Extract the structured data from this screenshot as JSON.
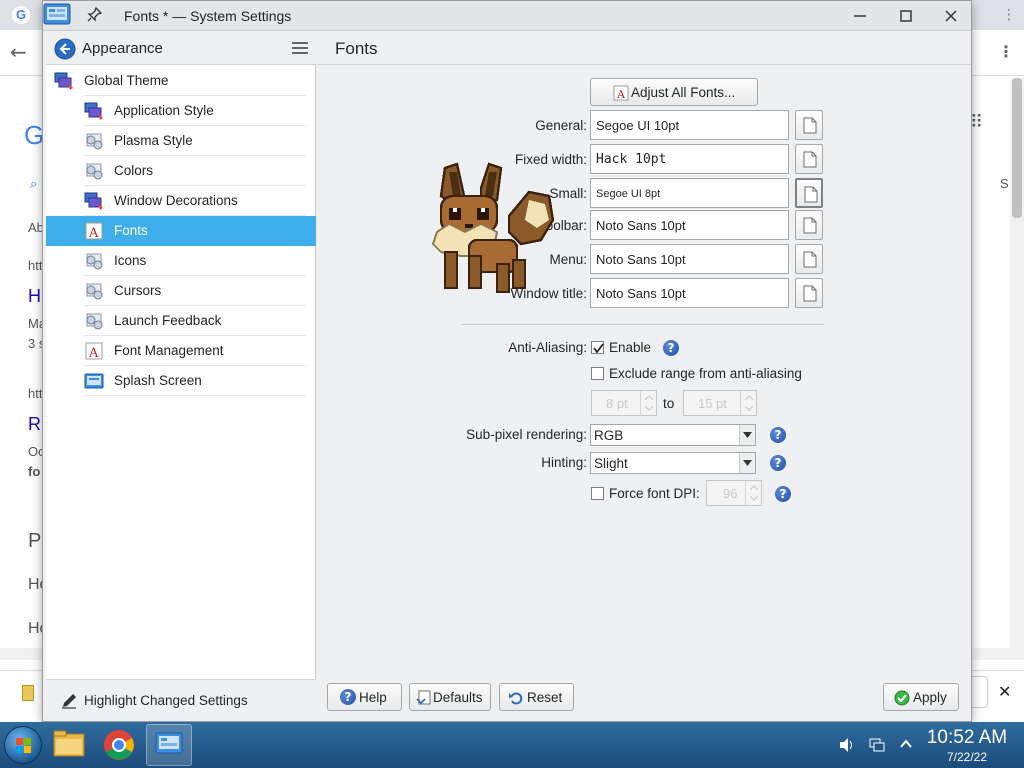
{
  "window": {
    "title": "Fonts * — System Settings"
  },
  "sidebar": {
    "header": "Appearance",
    "items": [
      {
        "label": "Global Theme",
        "indent": 0
      },
      {
        "label": "Application Style",
        "indent": 1
      },
      {
        "label": "Plasma Style",
        "indent": 1
      },
      {
        "label": "Colors",
        "indent": 1
      },
      {
        "label": "Window Decorations",
        "indent": 1
      },
      {
        "label": "Fonts",
        "indent": 1,
        "selected": true
      },
      {
        "label": "Icons",
        "indent": 1
      },
      {
        "label": "Cursors",
        "indent": 1
      },
      {
        "label": "Launch Feedback",
        "indent": 1
      },
      {
        "label": "Font Management",
        "indent": 1
      },
      {
        "label": "Splash Screen",
        "indent": 1
      }
    ],
    "footer": "Highlight Changed Settings"
  },
  "main": {
    "title": "Fonts",
    "adjust_all": "Adjust All Fonts...",
    "fields": [
      {
        "label": "General:",
        "value": "Segoe UI 10pt"
      },
      {
        "label": "Fixed width:",
        "value": "Hack 10pt"
      },
      {
        "label": "Small:",
        "value": "Segoe UI 8pt"
      },
      {
        "label": "Toolbar:",
        "value": "Noto Sans 10pt"
      },
      {
        "label": "Menu:",
        "value": "Noto Sans 10pt"
      },
      {
        "label": "Window title:",
        "value": "Noto Sans 10pt"
      }
    ],
    "antialiasing": {
      "label": "Anti-Aliasing:",
      "enable_label": "Enable",
      "enabled": true,
      "exclude_label": "Exclude range from anti-aliasing",
      "exclude": false,
      "from": "8 pt",
      "to_label": "to",
      "to": "15 pt"
    },
    "subpixel": {
      "label": "Sub-pixel rendering:",
      "value": "RGB"
    },
    "hinting": {
      "label": "Hinting:",
      "value": "Slight"
    },
    "force_dpi": {
      "label": "Force font DPI:",
      "checked": false,
      "value": "96"
    },
    "buttons": {
      "help": "Help",
      "defaults": "Defaults",
      "reset": "Reset",
      "apply": "Apply"
    }
  },
  "taskbar": {
    "time": "10:52 AM",
    "date": "7/22/22"
  },
  "background": {
    "fragments": [
      "Ab",
      "htt",
      "H",
      "Ma",
      "3 s",
      "htt",
      "R",
      "Oc",
      "fo",
      "Pe",
      "Ho",
      "Ho"
    ],
    "right_fragment": "S"
  },
  "colors": {
    "selection": "#3daee9",
    "window_bg": "#eff0f1",
    "taskbar": "#1f5585"
  },
  "icons": [
    "app-settings-icon",
    "pin-icon",
    "minimize-icon",
    "maximize-icon",
    "close-icon",
    "back-icon",
    "hamburger-icon",
    "font-icon",
    "help-icon",
    "defaults-icon",
    "reset-icon",
    "apply-icon",
    "eevee-sprite"
  ]
}
